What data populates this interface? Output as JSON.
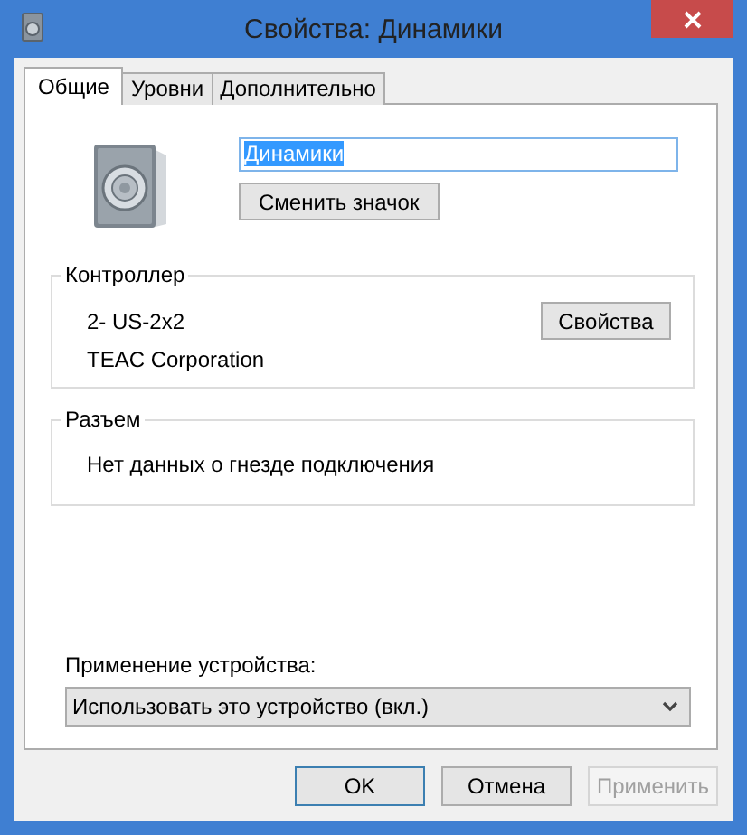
{
  "window": {
    "title": "Свойства: Динамики"
  },
  "tabs": [
    {
      "label": "Общие",
      "selected": true
    },
    {
      "label": "Уровни",
      "selected": false
    },
    {
      "label": "Дополнительно",
      "selected": false
    }
  ],
  "device_name": {
    "value": "Динамики",
    "text_selected": true
  },
  "change_icon_button": "Сменить значок",
  "controller": {
    "legend": "Контроллер",
    "name": "2- US-2x2",
    "vendor": "TEAC Corporation",
    "properties_button": "Свойства"
  },
  "jack": {
    "legend": "Разъем",
    "info": "Нет данных о гнезде подключения"
  },
  "device_usage": {
    "label": "Применение устройства:",
    "value": "Использовать это устройство (вкл.)"
  },
  "buttons": [
    {
      "label": "OK",
      "default": true,
      "disabled": false
    },
    {
      "label": "Отмена",
      "default": false,
      "disabled": false
    },
    {
      "label": "Применить",
      "default": false,
      "disabled": true
    }
  ]
}
